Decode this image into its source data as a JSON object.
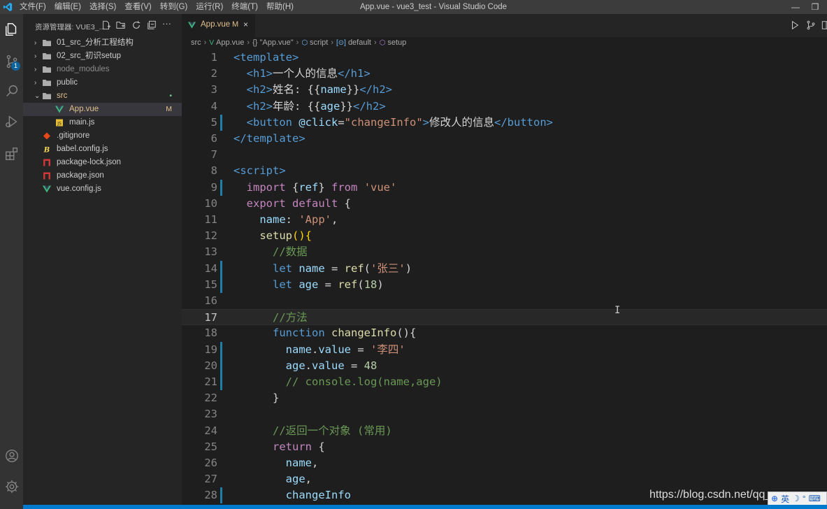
{
  "window": {
    "title": "App.vue - vue3_test - Visual Studio Code",
    "menu": [
      "文件(F)",
      "编辑(E)",
      "选择(S)",
      "查看(V)",
      "转到(G)",
      "运行(R)",
      "终端(T)",
      "帮助(H)"
    ]
  },
  "activity_bar": {
    "items": [
      {
        "icon": "files-icon"
      },
      {
        "icon": "source-control-icon",
        "badge": "1"
      },
      {
        "icon": "search-icon"
      },
      {
        "icon": "run-debug-icon"
      },
      {
        "icon": "extensions-icon"
      }
    ],
    "bottom": [
      {
        "icon": "account-icon"
      },
      {
        "icon": "settings-gear-icon"
      }
    ]
  },
  "explorer": {
    "title": "资源管理器: VUE3_...",
    "tree": [
      {
        "name": "01_src_分析工程结构",
        "type": "folder",
        "expanded": false
      },
      {
        "name": "02_src_初识setup",
        "type": "folder",
        "expanded": false
      },
      {
        "name": "node_modules",
        "type": "folder",
        "expanded": false,
        "dimmed": true
      },
      {
        "name": "public",
        "type": "folder",
        "expanded": false
      },
      {
        "name": "src",
        "type": "folder",
        "expanded": true,
        "status": "•"
      },
      {
        "name": "App.vue",
        "type": "vue",
        "status": "M",
        "selected": true
      },
      {
        "name": "main.js",
        "type": "js"
      },
      {
        "name": ".gitignore",
        "type": "git"
      },
      {
        "name": "babel.config.js",
        "type": "babel"
      },
      {
        "name": "package-lock.json",
        "type": "npm"
      },
      {
        "name": "package.json",
        "type": "npm"
      },
      {
        "name": "vue.config.js",
        "type": "vue"
      }
    ]
  },
  "editor": {
    "tab": {
      "label": "App.vue",
      "modified": "M",
      "close": "×"
    },
    "breadcrumb": [
      "src",
      "App.vue",
      "script",
      "default",
      "setup"
    ],
    "breadcrumb_app": "{} \"App.vue\"",
    "current_line": 17,
    "lines": [
      {
        "n": "1",
        "seg": [
          [
            "tag",
            "<template>"
          ]
        ]
      },
      {
        "n": "2",
        "seg": [
          [
            "text",
            "  "
          ],
          [
            "tag",
            "<h1>"
          ],
          [
            "text",
            "一个人的信息"
          ],
          [
            "tag",
            "</h1>"
          ]
        ]
      },
      {
        "n": "3",
        "seg": [
          [
            "text",
            "  "
          ],
          [
            "tag",
            "<h2>"
          ],
          [
            "text",
            "姓名: {{"
          ],
          [
            "var",
            "name"
          ],
          [
            "text",
            "}}"
          ],
          [
            "tag",
            "</h2>"
          ]
        ]
      },
      {
        "n": "4",
        "seg": [
          [
            "text",
            "  "
          ],
          [
            "tag",
            "<h2>"
          ],
          [
            "text",
            "年龄: {{"
          ],
          [
            "var",
            "age"
          ],
          [
            "text",
            "}}"
          ],
          [
            "tag",
            "</h2>"
          ]
        ]
      },
      {
        "n": "5",
        "seg": [
          [
            "text",
            "  "
          ],
          [
            "tag",
            "<button"
          ],
          [
            "var",
            " @click"
          ],
          [
            "text",
            "="
          ],
          [
            "str",
            "\"changeInfo\""
          ],
          [
            "tag",
            ">"
          ],
          [
            "text",
            "修改人的信息"
          ],
          [
            "tag",
            "</button>"
          ]
        ],
        "mark": true
      },
      {
        "n": "6",
        "seg": [
          [
            "tag",
            "</template>"
          ]
        ]
      },
      {
        "n": "7",
        "seg": []
      },
      {
        "n": "8",
        "seg": [
          [
            "tag",
            "<script>"
          ]
        ]
      },
      {
        "n": "9",
        "seg": [
          [
            "text",
            "  "
          ],
          [
            "kw",
            "import"
          ],
          [
            "text",
            " {"
          ],
          [
            "var",
            "ref"
          ],
          [
            "text",
            "} "
          ],
          [
            "kw",
            "from"
          ],
          [
            "text",
            " "
          ],
          [
            "str",
            "'vue'"
          ]
        ],
        "mark": true
      },
      {
        "n": "10",
        "seg": [
          [
            "text",
            "  "
          ],
          [
            "kw",
            "export"
          ],
          [
            "text",
            " "
          ],
          [
            "kw",
            "default"
          ],
          [
            "text",
            " {"
          ]
        ]
      },
      {
        "n": "11",
        "seg": [
          [
            "text",
            "    "
          ],
          [
            "var",
            "name"
          ],
          [
            "text",
            ": "
          ],
          [
            "str",
            "'App'"
          ],
          [
            "text",
            ","
          ]
        ]
      },
      {
        "n": "12",
        "seg": [
          [
            "text",
            "    "
          ],
          [
            "fn",
            "setup"
          ],
          [
            "br",
            "()"
          ],
          [
            "br",
            "{"
          ]
        ]
      },
      {
        "n": "13",
        "seg": [
          [
            "text",
            "      "
          ],
          [
            "cm",
            "//数据"
          ]
        ]
      },
      {
        "n": "14",
        "seg": [
          [
            "text",
            "      "
          ],
          [
            "kwb",
            "let"
          ],
          [
            "text",
            " "
          ],
          [
            "var",
            "name"
          ],
          [
            "text",
            " = "
          ],
          [
            "fn",
            "ref"
          ],
          [
            "text",
            "("
          ],
          [
            "str",
            "'张三'"
          ],
          [
            "text",
            ")"
          ]
        ],
        "mark": true
      },
      {
        "n": "15",
        "seg": [
          [
            "text",
            "      "
          ],
          [
            "kwb",
            "let"
          ],
          [
            "text",
            " "
          ],
          [
            "var",
            "age"
          ],
          [
            "text",
            " = "
          ],
          [
            "fn",
            "ref"
          ],
          [
            "text",
            "("
          ],
          [
            "num",
            "18"
          ],
          [
            "text",
            ")"
          ]
        ],
        "mark": true
      },
      {
        "n": "16",
        "seg": []
      },
      {
        "n": "17",
        "seg": [
          [
            "text",
            "      "
          ],
          [
            "cm",
            "//方法"
          ]
        ]
      },
      {
        "n": "18",
        "seg": [
          [
            "text",
            "      "
          ],
          [
            "kwb",
            "function"
          ],
          [
            "text",
            " "
          ],
          [
            "fn",
            "changeInfo"
          ],
          [
            "text",
            "(){"
          ]
        ]
      },
      {
        "n": "19",
        "seg": [
          [
            "text",
            "        "
          ],
          [
            "var",
            "name"
          ],
          [
            "text",
            "."
          ],
          [
            "var",
            "value"
          ],
          [
            "text",
            " = "
          ],
          [
            "str",
            "'李四'"
          ]
        ],
        "mark": true
      },
      {
        "n": "20",
        "seg": [
          [
            "text",
            "        "
          ],
          [
            "var",
            "age"
          ],
          [
            "text",
            "."
          ],
          [
            "var",
            "value"
          ],
          [
            "text",
            " = "
          ],
          [
            "num",
            "48"
          ]
        ],
        "mark": true
      },
      {
        "n": "21",
        "seg": [
          [
            "text",
            "        "
          ],
          [
            "cm",
            "// console.log(name,age)"
          ]
        ],
        "mark": true
      },
      {
        "n": "22",
        "seg": [
          [
            "text",
            "      }"
          ]
        ]
      },
      {
        "n": "23",
        "seg": []
      },
      {
        "n": "24",
        "seg": [
          [
            "text",
            "      "
          ],
          [
            "cm",
            "//返回一个对象 (常用)"
          ]
        ]
      },
      {
        "n": "25",
        "seg": [
          [
            "text",
            "      "
          ],
          [
            "kw",
            "return"
          ],
          [
            "text",
            " {"
          ]
        ]
      },
      {
        "n": "26",
        "seg": [
          [
            "text",
            "        "
          ],
          [
            "var",
            "name"
          ],
          [
            "text",
            ","
          ]
        ]
      },
      {
        "n": "27",
        "seg": [
          [
            "text",
            "        "
          ],
          [
            "var",
            "age"
          ],
          [
            "text",
            ","
          ]
        ]
      },
      {
        "n": "28",
        "seg": [
          [
            "text",
            "        "
          ],
          [
            "var",
            "changeInfo"
          ]
        ],
        "mark": true
      }
    ]
  },
  "overlay": {
    "watermark": "https://blog.csdn.net/qq_",
    "ime": [
      "英",
      "☽",
      "°",
      "⌨"
    ]
  },
  "colors": {
    "accent": "#007acc",
    "modified": "#e2c08d"
  }
}
